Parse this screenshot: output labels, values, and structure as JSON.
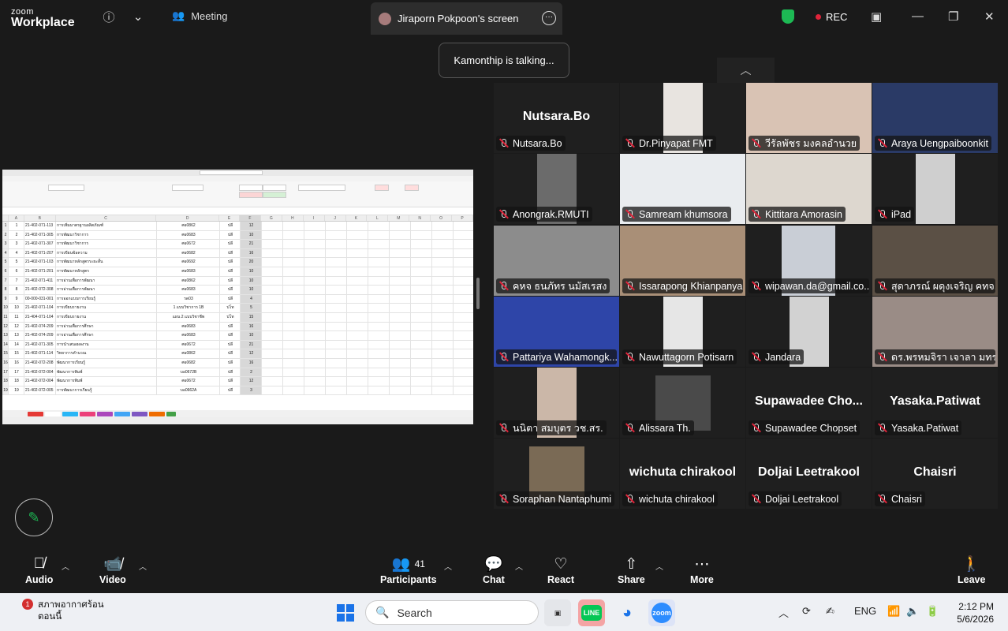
{
  "topbar": {
    "logo_line1": "zoom",
    "logo_line2": "Workplace",
    "meeting_label": "Meeting",
    "share_tab": "Jiraporn Pokpoon's screen",
    "rec_label": "REC"
  },
  "talking_banner": "Kamonthip is talking...",
  "participants": [
    {
      "display": "Nutsara.Bo",
      "label": "Nutsara.Bo"
    },
    {
      "display": "",
      "label": "Dr.Pinyapat FMT"
    },
    {
      "display": "",
      "label": "วีรัลพัชร มงคลอำนวย"
    },
    {
      "display": "",
      "label": "Araya Uengpaiboonkit"
    },
    {
      "display": "",
      "label": "Anongrak.RMUTI"
    },
    {
      "display": "",
      "label": "Samream khumsora"
    },
    {
      "display": "",
      "label": "Kittitara Amorasin"
    },
    {
      "display": "",
      "label": "iPad"
    },
    {
      "display": "",
      "label": "คหจ ธนภัทร นมัสเรสง"
    },
    {
      "display": "",
      "label": "Issarapong Khianpanya"
    },
    {
      "display": "",
      "label": "wipawan.da@gmail.co..."
    },
    {
      "display": "",
      "label": "สุดาภรณ์ ผดุงเจริญ คทจ..."
    },
    {
      "display": "",
      "label": "Pattariya Wahamongk..."
    },
    {
      "display": "",
      "label": "Nawuttagorn Potisarn"
    },
    {
      "display": "",
      "label": "Jandara"
    },
    {
      "display": "",
      "label": "ดร.พรหมจิรา เจาลา มทร.อี..."
    },
    {
      "display": "",
      "label": "นนิตา สมบุตร วช.สร."
    },
    {
      "display": "",
      "label": "Alissara Th."
    },
    {
      "display": "Supawadee  Cho...",
      "label": "Supawadee Chopset"
    },
    {
      "display": "Yasaka.Patiwat",
      "label": "Yasaka.Patiwat"
    },
    {
      "display": "",
      "label": "Soraphan Nantaphumi"
    },
    {
      "display": "wichuta chirakool",
      "label": "wichuta chirakool"
    },
    {
      "display": "Doljai Leetrakool",
      "label": "Doljai Leetrakool"
    },
    {
      "display": "Chaisri",
      "label": "Chaisri"
    }
  ],
  "spreadsheet": {
    "columns": [
      "A",
      "B",
      "C",
      "D",
      "E",
      "F",
      "G",
      "H",
      "I",
      "J",
      "K",
      "L",
      "M",
      "N",
      "O",
      "P"
    ],
    "rows": [
      [
        "1",
        "1",
        "21-402-071-113",
        "การเพิ่มมาตรฐานผลิตภัณฑ์",
        "ศอ0862",
        "ปลี",
        "12"
      ],
      [
        "2",
        "2",
        "21-402-071-305",
        "การพัฒนาวิชาการ",
        "ศอ0683",
        "ปลี",
        "10"
      ],
      [
        "3",
        "3",
        "21-402-071-307",
        "การพัฒนาวิชาการ",
        "ศอ0672",
        "ปลี",
        "21"
      ],
      [
        "4",
        "4",
        "21-402-071-207",
        "การเขียนข้อความ",
        "ศอ0682",
        "ปลี",
        "16"
      ],
      [
        "5",
        "5",
        "21-402-071-103",
        "การพัฒนาหลักสูตรระยะสั้น",
        "ศอ0692",
        "ปลี",
        "20"
      ],
      [
        "6",
        "6",
        "21-402-071-201",
        "การพัฒนาหลักสูตร",
        "ศอ0683",
        "ปลี",
        "10"
      ],
      [
        "7",
        "7",
        "21-402-071-411",
        "การอ่านเพื่อการพัฒนา",
        "ศอ0862",
        "ปลี",
        "10"
      ],
      [
        "8",
        "8",
        "21-402-072-308",
        "การอ่านเพื่อการพัฒนา",
        "ศอ0683",
        "ปลี",
        "10"
      ],
      [
        "9",
        "9",
        "00-000-031-001",
        "การออกแบบการเรียนรู้",
        "รด03",
        "ปลี",
        "4"
      ],
      [
        "10",
        "10",
        "21-402-071-104",
        "การเขียนรายงาน",
        "1 แบบวิชาการ 1B",
        "ปโท",
        "5"
      ],
      [
        "11",
        "11",
        "21-404-071-104",
        "การเขียนรายงาน",
        "แผน 2 แบบวิชาชีพ",
        "ปโท",
        "15"
      ],
      [
        "12",
        "12",
        "21-402-074-209",
        "การอ่านเพื่อการศึกษา",
        "ศอ0683",
        "ปลี",
        "16"
      ],
      [
        "13",
        "13",
        "21-402-074-209",
        "การอ่านเพื่อการศึกษา",
        "ศอ0683",
        "ปลี",
        "10"
      ],
      [
        "14",
        "14",
        "21-402-071-305",
        "การนำเสนอผลงาน",
        "ศอ0672",
        "ปลี",
        "21"
      ],
      [
        "15",
        "15",
        "21-402-071-114",
        "วิทยาการคำนวณ",
        "ศอ0862",
        "ปลี",
        "12"
      ],
      [
        "16",
        "16",
        "21-402-072-208",
        "พัฒนาการเรียนรู้",
        "ศอ0682",
        "ปลี",
        "16"
      ],
      [
        "17",
        "17",
        "21-402-072-004",
        "พัฒนาการพิมพ์",
        "บอ0672B",
        "ปลี",
        "2"
      ],
      [
        "18",
        "18",
        "21-402-072-004",
        "พัฒนาการพิมพ์",
        "ศอ0672",
        "ปลี",
        "12"
      ],
      [
        "19",
        "19",
        "21-402-072-005",
        "การพัฒนาการเรียนรู้",
        "บอ0662A",
        "ปลี",
        "3"
      ]
    ]
  },
  "controls": {
    "audio": "Audio",
    "video": "Video",
    "participants": "Participants",
    "participant_count": "41",
    "chat": "Chat",
    "react": "React",
    "share": "Share",
    "more": "More",
    "leave": "Leave"
  },
  "taskbar": {
    "weather_line1": "สภาพอากาศร้อน",
    "weather_line2": "ตอนนี้",
    "weather_badge": "1",
    "search_label": "Search",
    "lang": "ENG",
    "time": "2:12 PM",
    "date": "5/6/2026",
    "line_label": "LINE",
    "zoom_label": "zoom"
  }
}
